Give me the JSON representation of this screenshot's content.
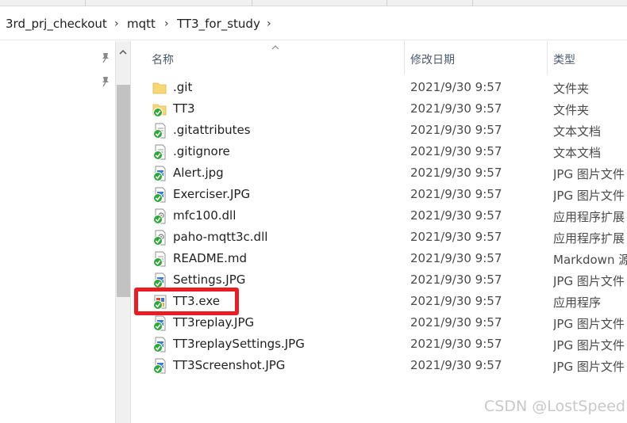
{
  "breadcrumb": {
    "items": [
      "3rd_prj_checkout",
      "mqtt",
      "TT3_for_study"
    ],
    "separator": "›"
  },
  "columns": {
    "name": "名称",
    "date": "修改日期",
    "type": "类型"
  },
  "files": [
    {
      "name": ".git",
      "date": "2021/9/30 9:57",
      "type": "文件夹",
      "icon": "folder-icon"
    },
    {
      "name": "TT3",
      "date": "2021/9/30 9:57",
      "type": "文件夹",
      "icon": "folder-synced-icon"
    },
    {
      "name": ".gitattributes",
      "date": "2021/9/30 9:57",
      "type": "文本文档",
      "icon": "text-file-synced-icon"
    },
    {
      "name": ".gitignore",
      "date": "2021/9/30 9:57",
      "type": "文本文档",
      "icon": "text-file-synced-icon"
    },
    {
      "name": "Alert.jpg",
      "date": "2021/9/30 9:57",
      "type": "JPG 图片文件",
      "icon": "image-file-synced-icon"
    },
    {
      "name": "Exerciser.JPG",
      "date": "2021/9/30 9:57",
      "type": "JPG 图片文件",
      "icon": "image-file-synced-icon"
    },
    {
      "name": "mfc100.dll",
      "date": "2021/9/30 9:57",
      "type": "应用程序扩展",
      "icon": "dll-file-synced-icon"
    },
    {
      "name": "paho-mqtt3c.dll",
      "date": "2021/9/30 9:57",
      "type": "应用程序扩展",
      "icon": "dll-file-synced-icon"
    },
    {
      "name": "README.md",
      "date": "2021/9/30 9:57",
      "type": "Markdown 源",
      "icon": "text-file-synced-icon"
    },
    {
      "name": "Settings.JPG",
      "date": "2021/9/30 9:57",
      "type": "JPG 图片文件",
      "icon": "image-file-synced-icon"
    },
    {
      "name": "TT3.exe",
      "date": "2021/9/30 9:57",
      "type": "应用程序",
      "icon": "exe-file-synced-icon"
    },
    {
      "name": "TT3replay.JPG",
      "date": "2021/9/30 9:57",
      "type": "JPG 图片文件",
      "icon": "image-file-synced-icon"
    },
    {
      "name": "TT3replaySettings.JPG",
      "date": "2021/9/30 9:57",
      "type": "JPG 图片文件",
      "icon": "image-file-synced-icon"
    },
    {
      "name": "TT3Screenshot.JPG",
      "date": "2021/9/30 9:57",
      "type": "JPG 图片文件",
      "icon": "image-file-synced-icon"
    }
  ],
  "watermark": "CSDN @LostSpeed",
  "colors": {
    "highlight": "#ea1c24",
    "folder": "#f8d775",
    "sync_badge": "#2fa83a"
  }
}
